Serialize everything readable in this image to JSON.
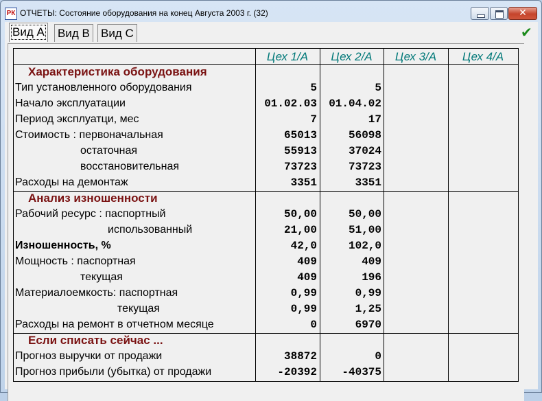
{
  "window": {
    "title": "ОТЧЕТЫ: Состояние оборудования на конец Августа 2003 г. (32)",
    "app_icon_text": "РК",
    "close_glyph": "✕",
    "ok_glyph": "✔"
  },
  "tabs": [
    {
      "label": "Вид А",
      "active": true
    },
    {
      "label": "Вид В",
      "active": false
    },
    {
      "label": "Вид С",
      "active": false
    }
  ],
  "columns": [
    "Цех 1/А",
    "Цех 2/А",
    "Цех 3/А",
    "Цех 4/А"
  ],
  "sections": {
    "s1": "Характеристика оборудования",
    "s2": "Анализ изношенности",
    "s3": "Если списать сейчас ..."
  },
  "rows": [
    {
      "label": "Тип установленного оборудования",
      "c1": "5",
      "c2": "5"
    },
    {
      "label": "Начало эксплуатации",
      "c1": "01.02.03",
      "c2": "01.04.02"
    },
    {
      "label": "Период эксплуатци, мес",
      "c1": "7",
      "c2": "17"
    },
    {
      "label": "Стоимость : первоначальная",
      "c1": "65013",
      "c2": "56098"
    },
    {
      "label": "остаточная",
      "c1": "55913",
      "c2": "37024"
    },
    {
      "label": "восстановительная",
      "c1": "73723",
      "c2": "73723"
    },
    {
      "label": "Расходы на демонтаж",
      "c1": "3351",
      "c2": "3351"
    },
    {
      "label": "Рабочий ресурс : паспортный",
      "c1": "50,00",
      "c2": "50,00"
    },
    {
      "label": "использованный",
      "c1": "21,00",
      "c2": "51,00"
    },
    {
      "label": "Изношенность, %",
      "c1": "42,0",
      "c2": "102,0"
    },
    {
      "label": "Мощность : паспортная",
      "c1": "409",
      "c2": "409"
    },
    {
      "label": "текущая",
      "c1": "409",
      "c2": "196"
    },
    {
      "label": "Материалоемкость: паспортная",
      "c1": "0,99",
      "c2": "0,99"
    },
    {
      "label": "текущая",
      "c1": "0,99",
      "c2": "1,25"
    },
    {
      "label": "Расходы на ремонт в отчетном месяце",
      "c1": "0",
      "c2": "6970"
    },
    {
      "label": "Прогноз выручки от продажи",
      "c1": "38872",
      "c2": "0"
    },
    {
      "label": "Прогноз прибыли (убытка) от продажи",
      "c1": "-20392",
      "c2": "-40375"
    }
  ]
}
